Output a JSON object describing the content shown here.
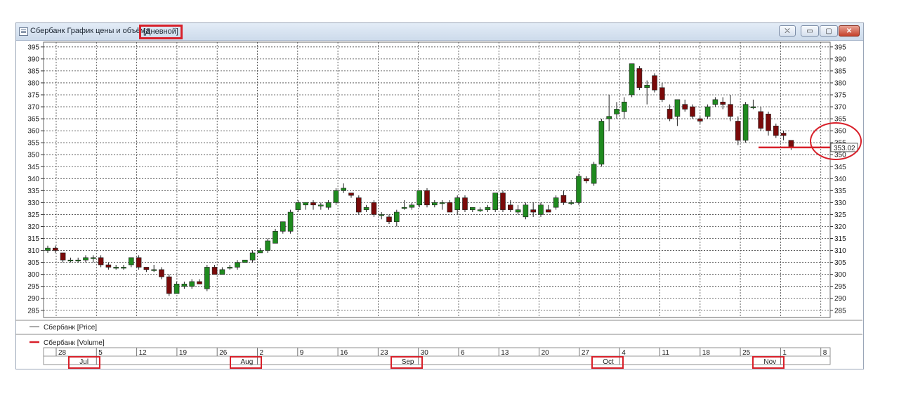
{
  "window": {
    "title": "Сбербанк График цены и объёма",
    "period": "[Дневной]",
    "buttons": {
      "pin": "⛌",
      "min": "▭",
      "max": "▢",
      "close": "✕"
    }
  },
  "colors": {
    "up": "#1f8a1f",
    "down": "#7a0a0a",
    "grid": "#444444",
    "price_line": "#d8202a",
    "annotation": "#d8202a"
  },
  "chart_data": {
    "type": "candlestick",
    "ylim": [
      282,
      397
    ],
    "yticks": [
      285,
      290,
      295,
      300,
      305,
      310,
      315,
      320,
      325,
      330,
      335,
      340,
      345,
      350,
      355,
      360,
      365,
      370,
      375,
      380,
      385,
      390,
      395
    ],
    "grid": true,
    "week_labels": [
      "28",
      "5",
      "12",
      "19",
      "26",
      "2",
      "9",
      "16",
      "23",
      "30",
      "6",
      "13",
      "20",
      "27",
      "4",
      "11",
      "18",
      "25",
      "1",
      "8"
    ],
    "months": [
      {
        "label": "Jul",
        "start_index": 1
      },
      {
        "label": "Aug",
        "start_index": 5
      },
      {
        "label": "Sep",
        "start_index": 9
      },
      {
        "label": "Oct",
        "start_index": 14
      },
      {
        "label": "Nov",
        "start_index": 18
      }
    ],
    "candles": [
      [
        310,
        312,
        309,
        311
      ],
      [
        311,
        312,
        309,
        310
      ],
      [
        309,
        309,
        305,
        306
      ],
      [
        306,
        307,
        305,
        306
      ],
      [
        306,
        307,
        305,
        306
      ],
      [
        306,
        308,
        305,
        307
      ],
      [
        307,
        308,
        305,
        307
      ],
      [
        307,
        308,
        303,
        304
      ],
      [
        304,
        305,
        302,
        303
      ],
      [
        303,
        304,
        302,
        303
      ],
      [
        303,
        304,
        302,
        303
      ],
      [
        304,
        307,
        303,
        307
      ],
      [
        307,
        308,
        302,
        303
      ],
      [
        303,
        303,
        301,
        302
      ],
      [
        302,
        304,
        301,
        302
      ],
      [
        302,
        303,
        298,
        299
      ],
      [
        299,
        300,
        291,
        292
      ],
      [
        292,
        297,
        292,
        296
      ],
      [
        295,
        297,
        294,
        296
      ],
      [
        295,
        298,
        294,
        297
      ],
      [
        297,
        298,
        296,
        296
      ],
      [
        294,
        304,
        293,
        303
      ],
      [
        303,
        304,
        300,
        300
      ],
      [
        300,
        303,
        300,
        302
      ],
      [
        303,
        304,
        302,
        303
      ],
      [
        303,
        306,
        302,
        305
      ],
      [
        305,
        306,
        305,
        306
      ],
      [
        306,
        310,
        305,
        309
      ],
      [
        309,
        311,
        309,
        310
      ],
      [
        310,
        315,
        309,
        314
      ],
      [
        313,
        319,
        313,
        318
      ],
      [
        318,
        322,
        317,
        322
      ],
      [
        318,
        327,
        317,
        326
      ],
      [
        327,
        331,
        326,
        330
      ],
      [
        329,
        330,
        327,
        330
      ],
      [
        330,
        331,
        327,
        329
      ],
      [
        329,
        330,
        327,
        329
      ],
      [
        328,
        331,
        327,
        330
      ],
      [
        330,
        336,
        329,
        335
      ],
      [
        335,
        338,
        334,
        336
      ],
      [
        334,
        334,
        332,
        333
      ],
      [
        332,
        333,
        325,
        326
      ],
      [
        327,
        329,
        326,
        328
      ],
      [
        330,
        331,
        324,
        325
      ],
      [
        325,
        326,
        323,
        325
      ],
      [
        324,
        325,
        321,
        322
      ],
      [
        322,
        327,
        320,
        326
      ],
      [
        328,
        331,
        327,
        328
      ],
      [
        328,
        330,
        327,
        329
      ],
      [
        329,
        335,
        328,
        335
      ],
      [
        335,
        336,
        328,
        329
      ],
      [
        329,
        331,
        328,
        330
      ],
      [
        330,
        331,
        327,
        330
      ],
      [
        330,
        331,
        327,
        326
      ],
      [
        327,
        333,
        325,
        332
      ],
      [
        332,
        333,
        326,
        327
      ],
      [
        327,
        328,
        326,
        328
      ],
      [
        327,
        328,
        326,
        327
      ],
      [
        327,
        329,
        326,
        328
      ],
      [
        327,
        334,
        326,
        334
      ],
      [
        334,
        335,
        326,
        327
      ],
      [
        329,
        331,
        326,
        327
      ],
      [
        326,
        329,
        325,
        327
      ],
      [
        324,
        330,
        323,
        329
      ],
      [
        327,
        330,
        324,
        326
      ],
      [
        325,
        330,
        324,
        329
      ],
      [
        327,
        329,
        326,
        326
      ],
      [
        328,
        333,
        327,
        332
      ],
      [
        333,
        335,
        329,
        330
      ],
      [
        330,
        331,
        329,
        330
      ],
      [
        330,
        342,
        329,
        341
      ],
      [
        340,
        341,
        338,
        339
      ],
      [
        338,
        347,
        337,
        346
      ],
      [
        346,
        365,
        345,
        364
      ],
      [
        365,
        375,
        360,
        366
      ],
      [
        367,
        372,
        365,
        369
      ],
      [
        368,
        374,
        365,
        372
      ],
      [
        375,
        388,
        374,
        388
      ],
      [
        386,
        387,
        377,
        378
      ],
      [
        378,
        381,
        371,
        379
      ],
      [
        383,
        384,
        376,
        377
      ],
      [
        378,
        380,
        372,
        373
      ],
      [
        369,
        371,
        364,
        365
      ],
      [
        366,
        373,
        362,
        373
      ],
      [
        371,
        373,
        368,
        369
      ],
      [
        370,
        371,
        365,
        366
      ],
      [
        365,
        366,
        363,
        364
      ],
      [
        366,
        371,
        365,
        370
      ],
      [
        371,
        374,
        370,
        373
      ],
      [
        372,
        374,
        369,
        371
      ],
      [
        371,
        375,
        364,
        366
      ],
      [
        364,
        366,
        354,
        356
      ],
      [
        356,
        372,
        355,
        371
      ],
      [
        370,
        373,
        369,
        370
      ],
      [
        368,
        370,
        360,
        361
      ],
      [
        367,
        368,
        358,
        360
      ],
      [
        362,
        363,
        357,
        358
      ],
      [
        359,
        360,
        356,
        358
      ],
      [
        356,
        356,
        352,
        353
      ]
    ],
    "last_price": 353.02,
    "last_price_label": "353.02",
    "legend": {
      "price": "Сбербанк [Price]",
      "volume": "Сбербанк [Volume]"
    }
  }
}
